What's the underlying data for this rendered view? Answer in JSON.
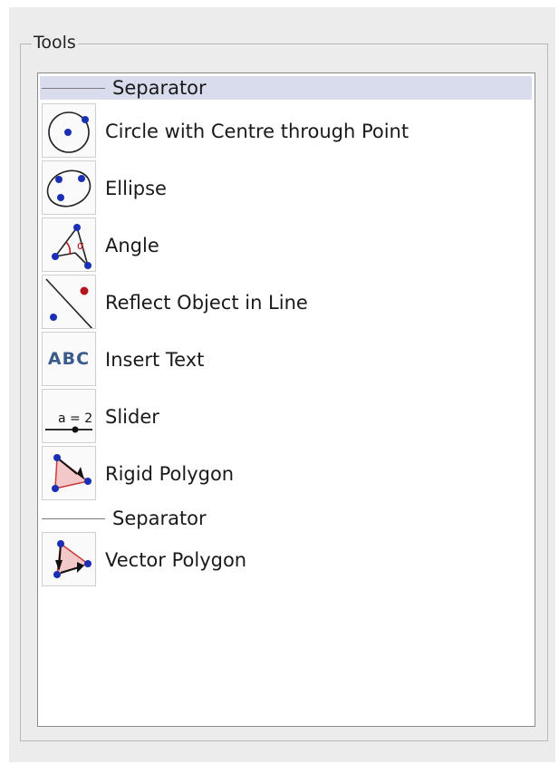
{
  "group": {
    "title": "Tools"
  },
  "colors": {
    "point_blue": "#1a2fb3",
    "point_red": "#b3161c",
    "abc_text": "#3a5a8a",
    "separator_selected": "#d9dcec"
  },
  "list": {
    "separator_1": "Separator",
    "items": [
      {
        "label": "Circle with Centre through Point",
        "icon": "circle-center-point-icon"
      },
      {
        "label": "Ellipse",
        "icon": "ellipse-icon"
      },
      {
        "label": "Angle",
        "icon": "angle-icon"
      },
      {
        "label": "Reflect Object in Line",
        "icon": "reflect-line-icon"
      },
      {
        "label": "Insert Text",
        "icon": "insert-text-icon",
        "icon_text": "ABC"
      },
      {
        "label": "Slider",
        "icon": "slider-icon",
        "icon_text": "a = 2"
      },
      {
        "label": "Rigid Polygon",
        "icon": "rigid-polygon-icon"
      }
    ],
    "separator_2": "Separator",
    "items_after": [
      {
        "label": "Vector Polygon",
        "icon": "vector-polygon-icon"
      }
    ]
  }
}
